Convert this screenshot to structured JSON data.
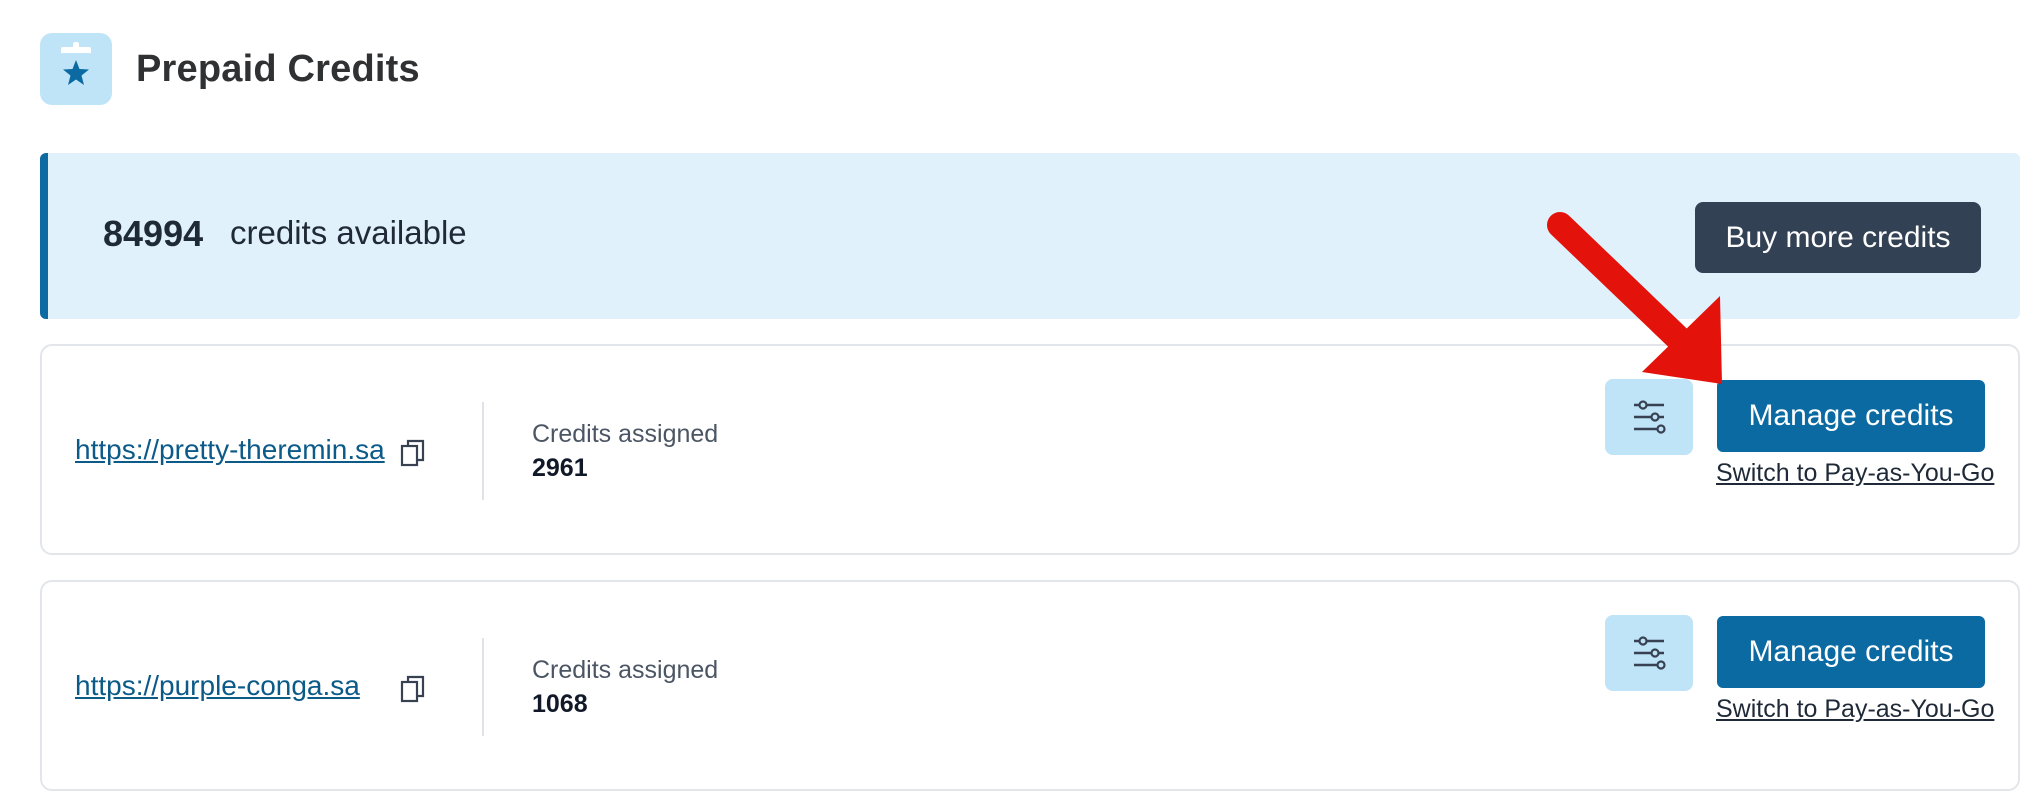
{
  "header": {
    "title": "Prepaid Credits",
    "icon": "prepaid-credit-icon"
  },
  "banner": {
    "credits_count": "84994",
    "credits_text": "credits available",
    "buy_button_label": "Buy more credits"
  },
  "sites": [
    {
      "url": "https://pretty-theremin.sa",
      "credits_label": "Credits assigned",
      "credits_value": "2961",
      "manage_button_label": "Manage credits",
      "switch_link_label": "Switch to Pay-as-You-Go"
    },
    {
      "url": "https://purple-conga.sa",
      "credits_label": "Credits assigned",
      "credits_value": "1068",
      "manage_button_label": "Manage credits",
      "switch_link_label": "Switch to Pay-as-You-Go"
    }
  ],
  "colors": {
    "accent": "#0b6aa2",
    "banner_bg": "#e0f1fc",
    "dark_button": "#334155",
    "annotation": "#e3120b"
  }
}
